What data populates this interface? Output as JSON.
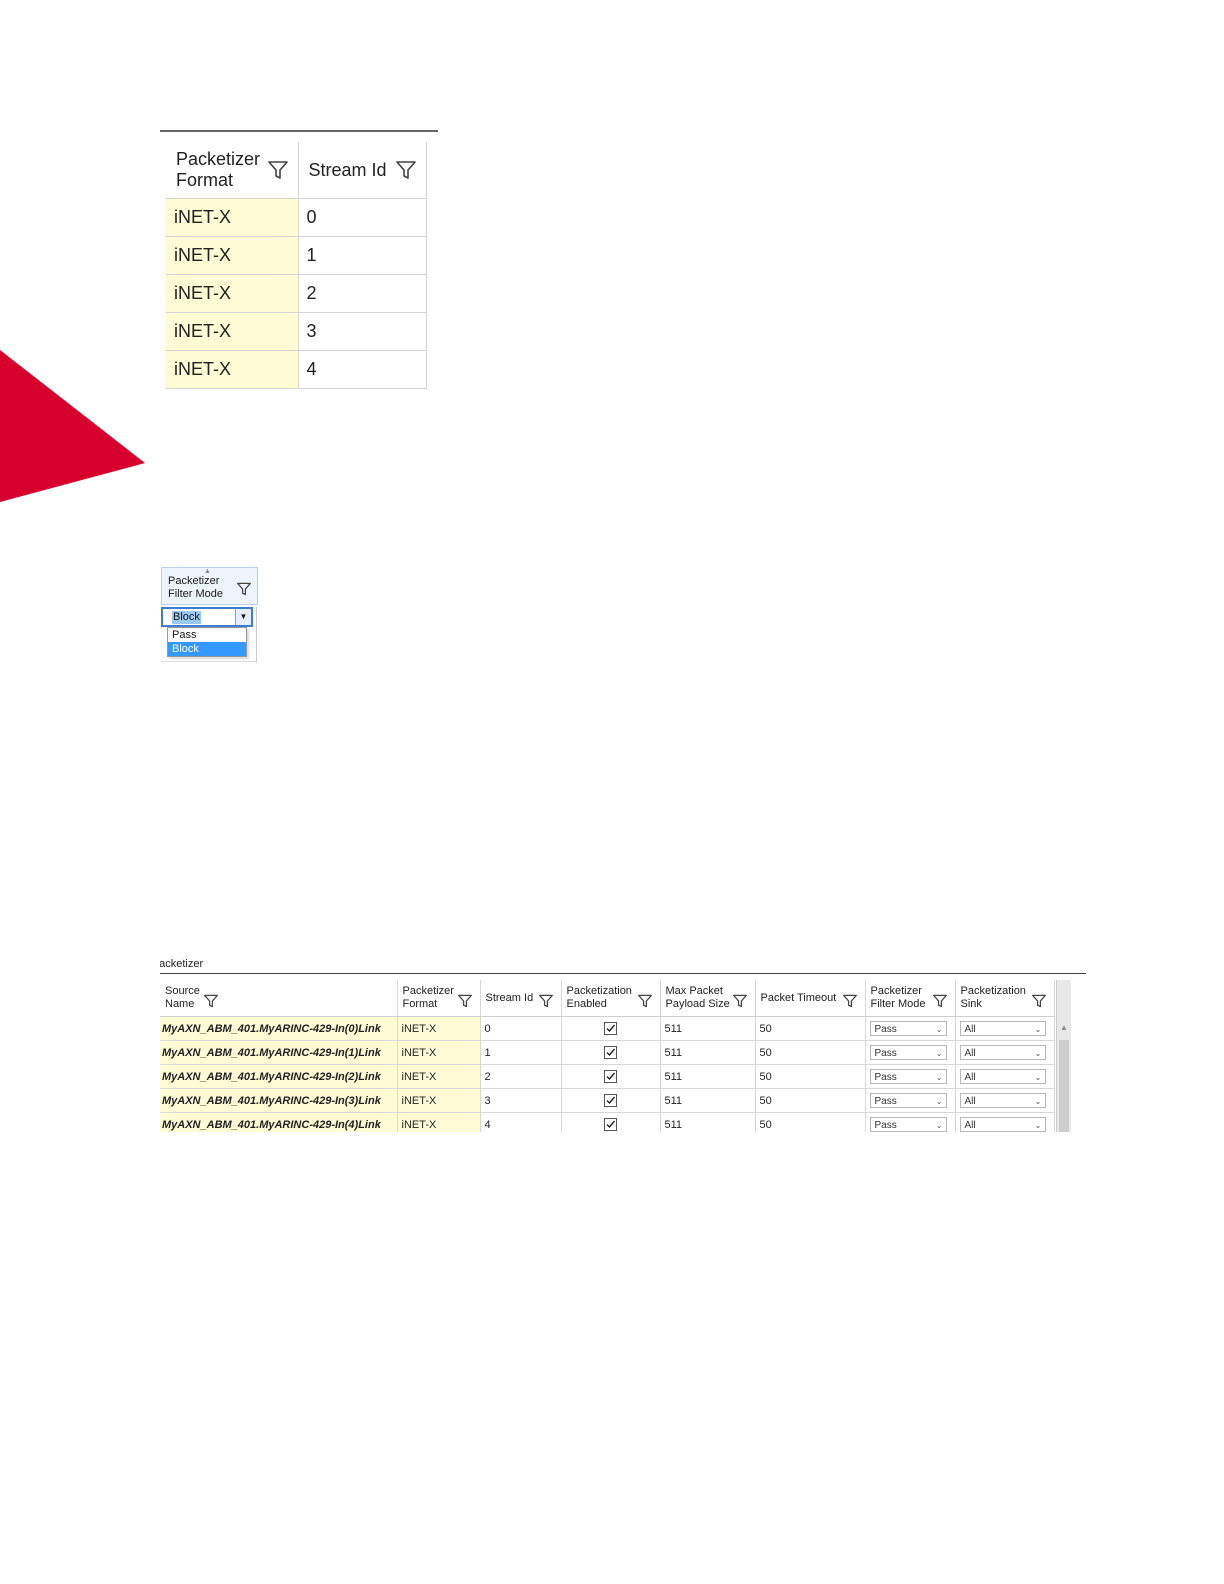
{
  "colors": {
    "accent_red": "#d7002d",
    "highlight_yellow": "#fffbd5",
    "selection_blue": "#3399ff"
  },
  "icons": {
    "filter": "funnel-filter-icon",
    "dropdown": "chevron-down-icon",
    "check": "checkmark-icon"
  },
  "zoom_grid": {
    "headers": {
      "format": "Packetizer Format",
      "format_l1": "Packetizer",
      "format_l2": "Format",
      "stream": "Stream Id"
    },
    "rows": [
      {
        "format": "iNET-X",
        "stream": "0"
      },
      {
        "format": "iNET-X",
        "stream": "1"
      },
      {
        "format": "iNET-X",
        "stream": "2"
      },
      {
        "format": "iNET-X",
        "stream": "3"
      },
      {
        "format": "iNET-X",
        "stream": "4"
      }
    ]
  },
  "filter_dropdown": {
    "header_l1": "Packetizer",
    "header_l2": "Filter Mode",
    "selected": "Block",
    "options": [
      "Pass",
      "Block"
    ]
  },
  "packetizer_grid": {
    "title": "'acketizer",
    "headers": {
      "source_l1": "Source",
      "source_l2": "Name",
      "format_l1": "Packetizer",
      "format_l2": "Format",
      "stream": "Stream Id",
      "enabled_l1": "Packetization",
      "enabled_l2": "Enabled",
      "payload_l1": "Max Packet",
      "payload_l2": "Payload Size",
      "timeout": "Packet Timeout",
      "filter_l1": "Packetizer",
      "filter_l2": "Filter Mode",
      "sink_l1": "Packetization",
      "sink_l2": "Sink"
    },
    "rows": [
      {
        "source": "MyAXN_ABM_401.MyARINC-429-In(0)Link",
        "format": "iNET-X",
        "stream": "0",
        "enabled": true,
        "payload": "511",
        "timeout": "50",
        "filter": "Pass",
        "sink": "All"
      },
      {
        "source": "MyAXN_ABM_401.MyARINC-429-In(1)Link",
        "format": "iNET-X",
        "stream": "1",
        "enabled": true,
        "payload": "511",
        "timeout": "50",
        "filter": "Pass",
        "sink": "All"
      },
      {
        "source": "MyAXN_ABM_401.MyARINC-429-In(2)Link",
        "format": "iNET-X",
        "stream": "2",
        "enabled": true,
        "payload": "511",
        "timeout": "50",
        "filter": "Pass",
        "sink": "All"
      },
      {
        "source": "MyAXN_ABM_401.MyARINC-429-In(3)Link",
        "format": "iNET-X",
        "stream": "3",
        "enabled": true,
        "payload": "511",
        "timeout": "50",
        "filter": "Pass",
        "sink": "All"
      },
      {
        "source": "MyAXN_ABM_401.MyARINC-429-In(4)Link",
        "format": "iNET-X",
        "stream": "4",
        "enabled": true,
        "payload": "511",
        "timeout": "50",
        "filter": "Pass",
        "sink": "All"
      }
    ]
  }
}
